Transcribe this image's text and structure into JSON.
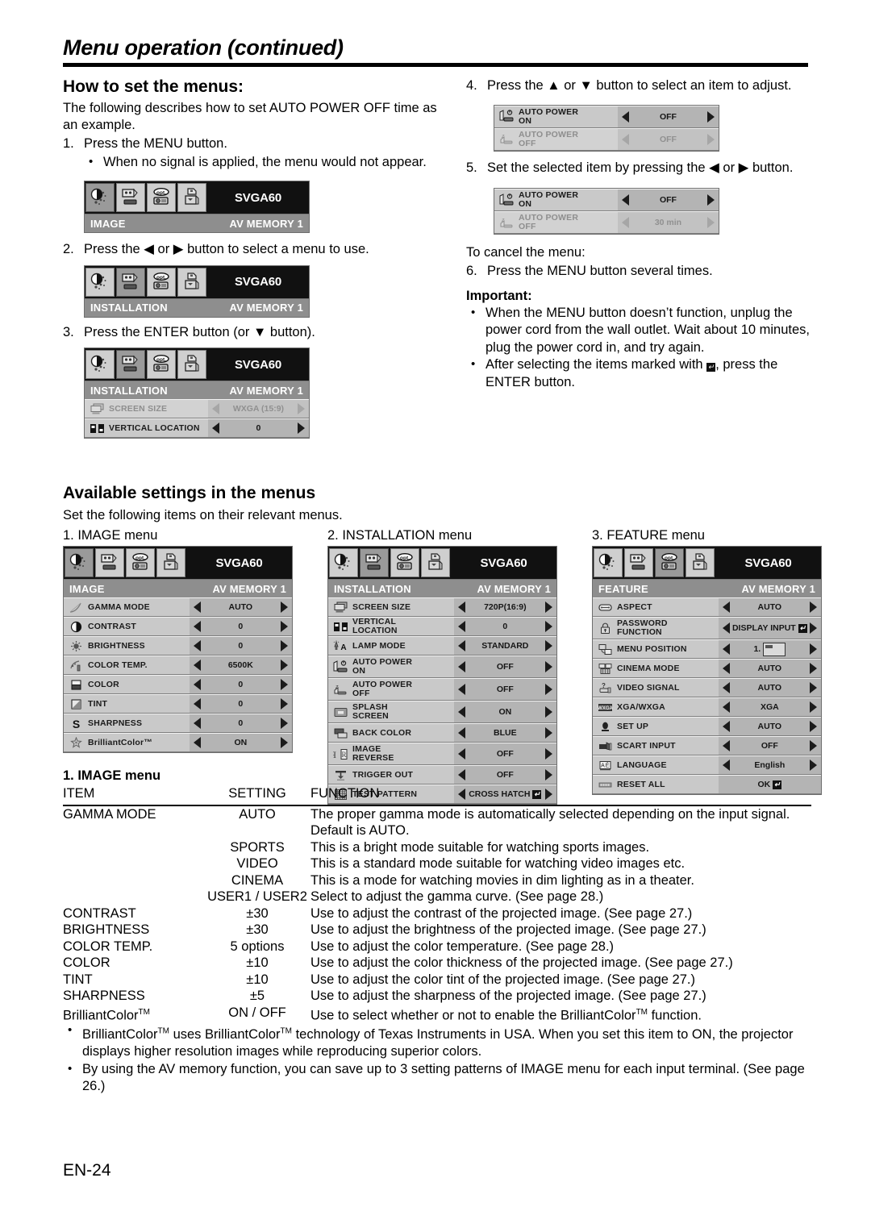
{
  "header": {
    "title": "Menu operation (continued)"
  },
  "how_to": {
    "heading": "How to set the menus:",
    "intro": "The following describes how to set AUTO POWER OFF time as an example.",
    "steps": [
      {
        "num": "1.",
        "text": "Press the MENU button."
      },
      {
        "num": "2.",
        "text": "Press the ◀ or ▶ button to select a menu to use."
      },
      {
        "num": "3.",
        "text": "Press the ENTER button (or ▼ button)."
      }
    ],
    "step1_bullet": "When no signal is applied, the menu would not appear."
  },
  "right_col": {
    "step4": {
      "num": "4.",
      "text": "Press the ▲ or ▼ button to select an item to adjust."
    },
    "step5": {
      "num": "5.",
      "text": "Set the selected item by pressing the ◀ or ▶ button."
    },
    "cancel_heading": "To cancel the menu:",
    "step6": {
      "num": "6.",
      "text": "Press the MENU button several times."
    },
    "important_heading": "Important:",
    "important_bullets": [
      "When the MENU button doesn’t function,  unplug the power cord from the wall outlet. Wait about 10 minutes, plug the power cord in, and try again.",
      "After selecting the items marked with ↵, press the ENTER button."
    ]
  },
  "osd_common": {
    "signal": "SVGA60",
    "av_memory": "AV MEMORY 1",
    "tabs": [
      {
        "name": "image-tab",
        "icon": "contrast-sparkle-icon"
      },
      {
        "name": "installation-tab",
        "icon": "screen-projector-icon"
      },
      {
        "name": "feature-tab",
        "icon": "opt-projector-icon"
      },
      {
        "name": "signal-tab",
        "icon": "signal-memory-icon"
      }
    ]
  },
  "osd_step1": {
    "title": "IMAGE",
    "av_memory": "AV MEMORY 1",
    "signal": "SVGA60",
    "selected_tab": 0
  },
  "osd_step2": {
    "title": "INSTALLATION",
    "av_memory": "AV MEMORY 1",
    "signal": "SVGA60",
    "selected_tab": 1
  },
  "osd_step3": {
    "title": "INSTALLATION",
    "av_memory": "AV MEMORY 1",
    "signal": "SVGA60",
    "selected_tab": 1,
    "rows": [
      {
        "label": "SCREEN SIZE",
        "value": "WXGA (15:9)",
        "icon": "screen-size-icon",
        "dim": true
      },
      {
        "label": "VERTICAL LOCATION",
        "value": "0",
        "icon": "vertical-location-icon",
        "dim": false
      }
    ]
  },
  "osd_step4": {
    "rows": [
      {
        "label": "AUTO POWER ON",
        "label_lines": [
          "AUTO POWER",
          "ON"
        ],
        "value": "OFF",
        "icon": "auto-power-on-icon",
        "dim": false
      },
      {
        "label": "AUTO POWER OFF",
        "label_lines": [
          "AUTO POWER",
          "OFF"
        ],
        "value": "OFF",
        "icon": "auto-power-off-icon",
        "dim": true
      }
    ]
  },
  "osd_step5": {
    "rows": [
      {
        "label": "AUTO POWER ON",
        "label_lines": [
          "AUTO POWER",
          "ON"
        ],
        "value": "OFF",
        "icon": "auto-power-on-icon",
        "dim": false
      },
      {
        "label": "AUTO POWER OFF",
        "label_lines": [
          "AUTO POWER",
          "OFF"
        ],
        "value": "30 min",
        "icon": "auto-power-off-icon",
        "dim": true
      }
    ]
  },
  "available": {
    "heading": "Available settings in the menus",
    "subtext": "Set the following items on their relevant menus.",
    "captions": {
      "image": "1. IMAGE menu",
      "installation": "2. INSTALLATION menu",
      "feature": "3. FEATURE menu"
    }
  },
  "menu_image": {
    "title": "IMAGE",
    "av_memory": "AV MEMORY 1",
    "signal": "SVGA60",
    "selected_tab": 0,
    "rows": [
      {
        "label": "GAMMA MODE",
        "value": "AUTO",
        "icon": "gamma-curve-icon"
      },
      {
        "label": "CONTRAST",
        "value": "0",
        "icon": "contrast-icon"
      },
      {
        "label": "BRIGHTNESS",
        "value": "0",
        "icon": "brightness-icon"
      },
      {
        "label": "COLOR TEMP.",
        "value": "6500K",
        "icon": "color-temp-icon"
      },
      {
        "label": "COLOR",
        "value": "0",
        "icon": "color-icon"
      },
      {
        "label": "TINT",
        "value": "0",
        "icon": "tint-icon"
      },
      {
        "label": "SHARPNESS",
        "value": "0",
        "icon": "sharpness-s-icon"
      },
      {
        "label": "BrilliantColor™",
        "value": "ON",
        "icon": "brilliantcolor-icon"
      }
    ]
  },
  "menu_installation": {
    "title": "INSTALLATION",
    "av_memory": "AV MEMORY 1",
    "signal": "SVGA60",
    "selected_tab": 1,
    "rows": [
      {
        "label": "SCREEN SIZE",
        "value": "720P(16:9)",
        "icon": "screen-size-icon"
      },
      {
        "label": "VERTICAL LOCATION",
        "label_lines": [
          "VERTICAL",
          "LOCATION"
        ],
        "value": "0",
        "icon": "vertical-location-icon"
      },
      {
        "label": "LAMP MODE",
        "value": "STANDARD",
        "icon": "lamp-mode-icon"
      },
      {
        "label": "AUTO POWER ON",
        "label_lines": [
          "AUTO POWER",
          "ON"
        ],
        "value": "OFF",
        "icon": "auto-power-on-icon"
      },
      {
        "label": "AUTO POWER OFF",
        "label_lines": [
          "AUTO POWER",
          "OFF"
        ],
        "value": "OFF",
        "icon": "auto-power-off-icon"
      },
      {
        "label": "SPLASH SCREEN",
        "label_lines": [
          "SPLASH",
          "SCREEN"
        ],
        "value": "ON",
        "icon": "splash-screen-icon"
      },
      {
        "label": "BACK COLOR",
        "value": "BLUE",
        "icon": "back-color-icon"
      },
      {
        "label": "IMAGE REVERSE",
        "label_lines": [
          "IMAGE",
          "REVERSE"
        ],
        "value": "OFF",
        "icon": "image-reverse-icon"
      },
      {
        "label": "TRIGGER OUT",
        "value": "OFF",
        "icon": "trigger-out-icon"
      },
      {
        "label": "TEST PATTERN",
        "value": "CROSS HATCH",
        "value_enter": true,
        "icon": "test-pattern-icon"
      }
    ]
  },
  "menu_feature": {
    "title": "FEATURE",
    "av_memory": "AV MEMORY 1",
    "signal": "SVGA60",
    "selected_tab": 2,
    "rows": [
      {
        "label": "ASPECT",
        "value": "AUTO",
        "icon": "aspect-icon"
      },
      {
        "label": "PASSWORD FUNCTION",
        "label_lines": [
          "PASSWORD",
          "FUNCTION"
        ],
        "value": "DISPLAY INPUT",
        "value_enter": true,
        "icon": "password-lock-icon"
      },
      {
        "label": "MENU POSITION",
        "value": "1.",
        "value_menupos": true,
        "icon": "menu-position-icon"
      },
      {
        "label": "CINEMA MODE",
        "value": "AUTO",
        "icon": "cinema-mode-icon"
      },
      {
        "label": "VIDEO SIGNAL",
        "value": "AUTO",
        "icon": "video-signal-icon"
      },
      {
        "label": "XGA/WXGA",
        "value": "XGA",
        "icon": "xga-wxga-icon"
      },
      {
        "label": "SET UP",
        "value": "AUTO",
        "icon": "set-up-icon"
      },
      {
        "label": "SCART INPUT",
        "value": "OFF",
        "icon": "scart-input-icon"
      },
      {
        "label": "LANGUAGE",
        "value": "English",
        "icon": "language-icon"
      },
      {
        "label": "RESET ALL",
        "value": "OK",
        "value_enter": true,
        "no_arrows": true,
        "icon": "reset-all-icon"
      }
    ]
  },
  "table": {
    "title": "1. IMAGE menu",
    "headers": {
      "item": "ITEM",
      "setting": "SETTING",
      "function": "FUNCTION"
    },
    "rows": [
      {
        "item": "GAMMA MODE",
        "setting": "AUTO",
        "function": "The proper gamma mode is automatically selected depending on the input signal. Default is AUTO."
      },
      {
        "item": "",
        "setting": "SPORTS",
        "function": "This is a bright mode suitable for watching sports images."
      },
      {
        "item": "",
        "setting": "VIDEO",
        "function": "This is a standard mode suitable for watching video images etc."
      },
      {
        "item": "",
        "setting": "CINEMA",
        "function": "This is a mode for watching movies in dim lighting as in a theater."
      },
      {
        "item": "",
        "setting": "USER1 / USER2",
        "function": "Select to adjust the gamma curve. (See page 28.)"
      },
      {
        "item": "CONTRAST",
        "setting": "±30",
        "function": "Use to adjust the contrast of the projected image. (See page 27.)"
      },
      {
        "item": "BRIGHTNESS",
        "setting": "±30",
        "function": "Use to adjust the brightness of the projected image. (See page 27.)"
      },
      {
        "item": "COLOR TEMP.",
        "setting": "5 options",
        "function": "Use to adjust the color temperature. (See page 28.)"
      },
      {
        "item": "COLOR",
        "setting": "±10",
        "function": "Use to adjust the color thickness of the projected image. (See page 27.)"
      },
      {
        "item": "TINT",
        "setting": "±10",
        "function": "Use to adjust the color tint of the projected image. (See page 27.)"
      },
      {
        "item": "SHARPNESS",
        "setting": "±5",
        "function": "Use to adjust the sharpness of the projected image. (See page 27.)"
      },
      {
        "item": "BrilliantColor™",
        "item_tm": true,
        "setting": "ON / OFF",
        "function": "Use to select whether or not to enable the BrilliantColor™ function.",
        "function_tm": true
      }
    ]
  },
  "footer_bullets": [
    "BrilliantColor™ uses BrilliantColor™ technology of Texas Instruments in USA. When you set this item to ON, the projector displays higher resolution images while reproducing superior colors.",
    "By using the AV memory function, you can save up to 3 setting patterns of IMAGE menu for each input terminal. (See page 26.)"
  ],
  "page_number": "EN-24"
}
